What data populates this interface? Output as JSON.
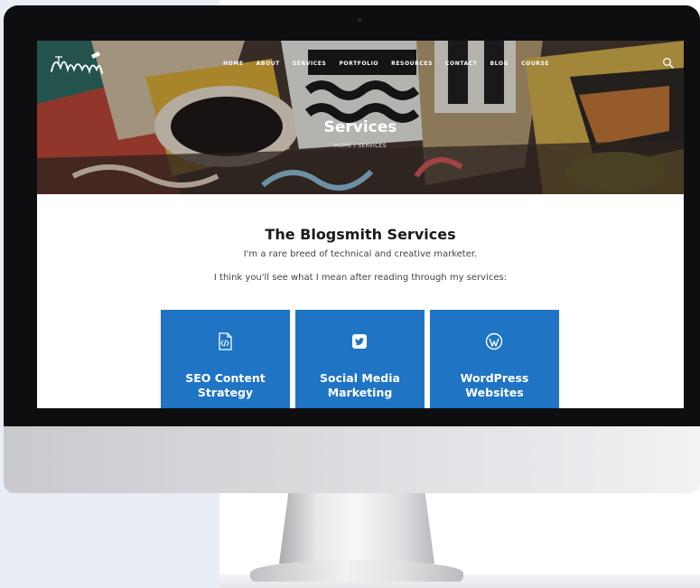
{
  "site": {
    "logo_text": "The Blogsmith",
    "nav": [
      {
        "label": "HOME"
      },
      {
        "label": "ABOUT"
      },
      {
        "label": "SERVICES"
      },
      {
        "label": "PORTFOLIO"
      },
      {
        "label": "RESOURCES"
      },
      {
        "label": "CONTACT"
      },
      {
        "label": "BLOG"
      },
      {
        "label": "COURSE"
      }
    ],
    "search_icon": "search-icon"
  },
  "hero": {
    "title": "Services",
    "breadcrumb": "HOME / SERVICES"
  },
  "main": {
    "heading": "The Blogsmith Services",
    "lead_1": "I'm a rare breed of technical and creative marketer.",
    "lead_2": "I think you'll see what I mean after reading through my services:",
    "cards": [
      {
        "icon": "code-document-icon",
        "title_line1": "SEO Content",
        "title_line2": "Strategy"
      },
      {
        "icon": "twitter-icon",
        "title_line1": "Social Media",
        "title_line2": "Marketing"
      },
      {
        "icon": "wordpress-icon",
        "title_line1": "WordPress",
        "title_line2": "Websites"
      }
    ]
  },
  "colors": {
    "card_blue": "#1f74c4",
    "page_background_left": "#e9edf4",
    "bezel": "#0e0e10"
  }
}
